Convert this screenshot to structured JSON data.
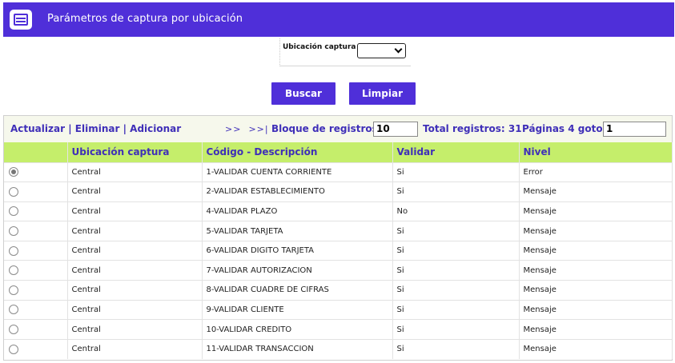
{
  "header": {
    "title": "Parámetros de captura por ubicación",
    "icon": "list-window-icon",
    "color": "#4f2fd9"
  },
  "filter": {
    "label": "Ubicación captura",
    "selected": ""
  },
  "actions": {
    "search_label": "Buscar",
    "clear_label": "Limpiar"
  },
  "toolbar": {
    "update": "Actualizar",
    "delete": "Eliminar",
    "add": "Adicionar",
    "sep": "|",
    "next": ">>",
    "last": ">>|",
    "block_label": "Bloque de registros:",
    "block_value": "10",
    "total_label": "Total registros: 31",
    "pages_label": "Páginas 4 goto:",
    "goto_value": "1"
  },
  "table": {
    "columns": [
      "Ubicación captura",
      "Código - Descripción",
      "Validar",
      "Nivel"
    ],
    "rows": [
      {
        "selected": true,
        "ubicacion": "Central",
        "codigo": "1-VALIDAR CUENTA CORRIENTE",
        "validar": "Si",
        "nivel": "Error"
      },
      {
        "selected": false,
        "ubicacion": "Central",
        "codigo": "2-VALIDAR ESTABLECIMIENTO",
        "validar": "Si",
        "nivel": "Mensaje"
      },
      {
        "selected": false,
        "ubicacion": "Central",
        "codigo": "4-VALIDAR PLAZO",
        "validar": "No",
        "nivel": "Mensaje"
      },
      {
        "selected": false,
        "ubicacion": "Central",
        "codigo": "5-VALIDAR TARJETA",
        "validar": "Si",
        "nivel": "Mensaje"
      },
      {
        "selected": false,
        "ubicacion": "Central",
        "codigo": "6-VALIDAR DIGITO TARJETA",
        "validar": "Si",
        "nivel": "Mensaje"
      },
      {
        "selected": false,
        "ubicacion": "Central",
        "codigo": "7-VALIDAR AUTORIZACION",
        "validar": "Si",
        "nivel": "Mensaje"
      },
      {
        "selected": false,
        "ubicacion": "Central",
        "codigo": "8-VALIDAR CUADRE DE CIFRAS",
        "validar": "Si",
        "nivel": "Mensaje"
      },
      {
        "selected": false,
        "ubicacion": "Central",
        "codigo": "9-VALIDAR CLIENTE",
        "validar": "Si",
        "nivel": "Mensaje"
      },
      {
        "selected": false,
        "ubicacion": "Central",
        "codigo": "10-VALIDAR CREDITO",
        "validar": "Si",
        "nivel": "Mensaje"
      },
      {
        "selected": false,
        "ubicacion": "Central",
        "codigo": "11-VALIDAR TRANSACCION",
        "validar": "Si",
        "nivel": "Mensaje"
      }
    ]
  },
  "colors": {
    "accent": "#4f2fd9",
    "header_row": "#c5ee6b",
    "link": "#3f2fb8",
    "toolbar_bg": "#f6f8ec"
  }
}
